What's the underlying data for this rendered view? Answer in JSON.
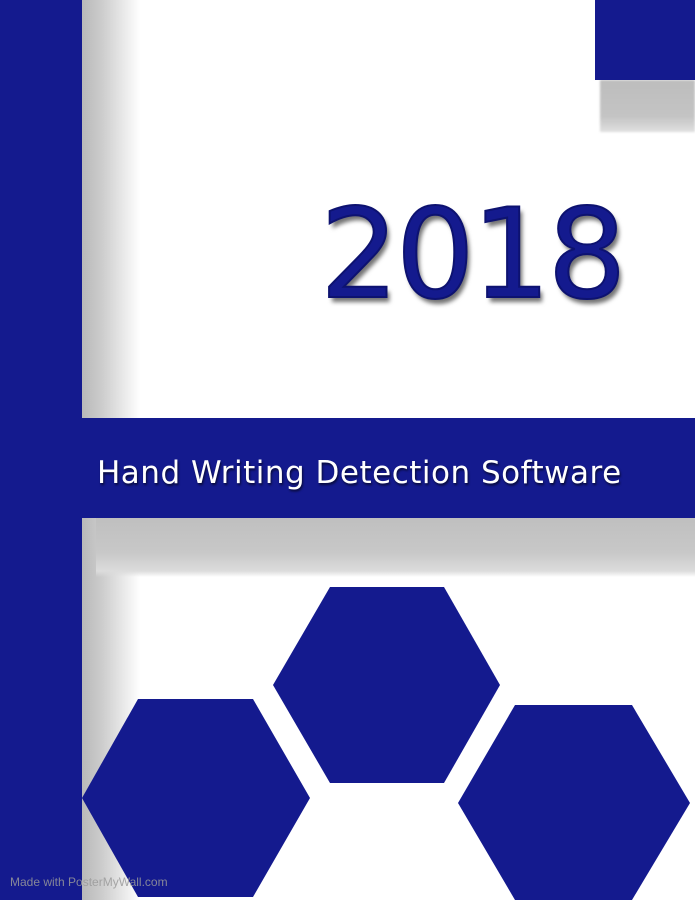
{
  "poster": {
    "year": "2018",
    "title": "Hand Writing Detection Software",
    "watermark": "Made with PosterMyWall.com"
  },
  "colors": {
    "primary_blue": "#141a8e",
    "background": "#ffffff",
    "shadow_grey": "#c4c4c4",
    "text_white": "#ffffff"
  },
  "shapes": {
    "hexagons": [
      "hexagon-top-center",
      "hexagon-bottom-left",
      "hexagon-bottom-right"
    ]
  }
}
